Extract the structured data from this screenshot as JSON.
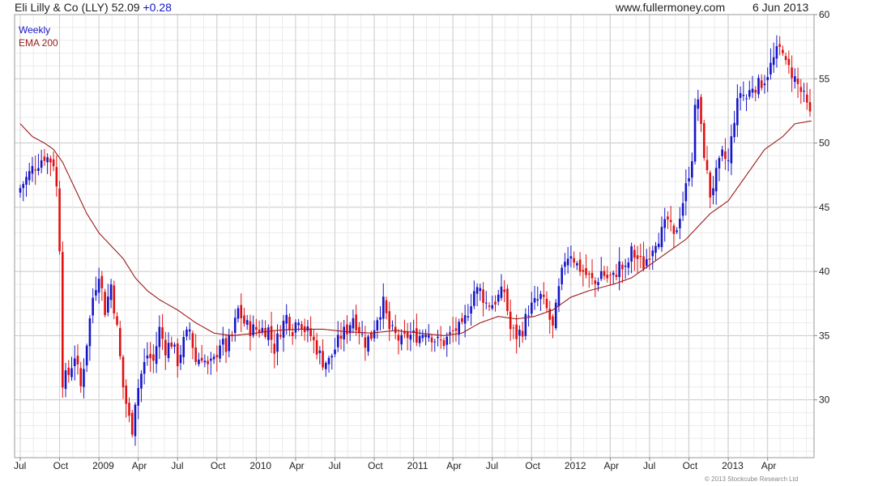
{
  "header": {
    "security": "Eli Lilly & Co (LLY)",
    "last_price": "52.09",
    "change": "+0.28",
    "website": "www.fullermoney.com",
    "date": "6 Jun 2013"
  },
  "legend": {
    "period": "Weekly",
    "indicator": "EMA 200"
  },
  "copyright": "© 2013 Stockcube Research Ltd",
  "colors": {
    "up": "#1515c8",
    "down": "#e01010",
    "ema": "#9b1b1b",
    "grid": "#d6d6d6"
  },
  "chart_data": {
    "type": "candlestick",
    "interval": "weekly",
    "y_ticks": [
      30,
      35,
      40,
      45,
      50,
      55,
      60
    ],
    "x_ticks": [
      {
        "label": "Jul",
        "week": 0
      },
      {
        "label": "Oct",
        "week": 13
      },
      {
        "label": "2009",
        "week": 26
      },
      {
        "label": "Apr",
        "week": 39
      },
      {
        "label": "Jul",
        "week": 52
      },
      {
        "label": "Oct",
        "week": 65
      },
      {
        "label": "2010",
        "week": 78
      },
      {
        "label": "Apr",
        "week": 91
      },
      {
        "label": "Jul",
        "week": 104
      },
      {
        "label": "Oct",
        "week": 117
      },
      {
        "label": "2011",
        "week": 130
      },
      {
        "label": "Apr",
        "week": 143
      },
      {
        "label": "Jul",
        "week": 156
      },
      {
        "label": "Oct",
        "week": 169
      },
      {
        "label": "2012",
        "week": 182
      },
      {
        "label": "Apr",
        "week": 195
      },
      {
        "label": "Jul",
        "week": 208
      },
      {
        "label": "Oct",
        "week": 221
      },
      {
        "label": "2013",
        "week": 234
      },
      {
        "label": "Apr",
        "week": 247
      }
    ],
    "ylim": [
      25.5,
      60
    ],
    "weeks": 262,
    "close_path": [
      [
        0,
        46.5
      ],
      [
        4,
        48.0
      ],
      [
        8,
        49.0
      ],
      [
        11,
        48.5
      ],
      [
        12,
        46.5
      ],
      [
        13,
        42.0
      ],
      [
        14,
        31.5
      ],
      [
        16,
        32.0
      ],
      [
        18,
        33.5
      ],
      [
        20,
        31.0
      ],
      [
        22,
        34.5
      ],
      [
        24,
        38.0
      ],
      [
        26,
        40.0
      ],
      [
        28,
        37.0
      ],
      [
        30,
        39.0
      ],
      [
        32,
        35.5
      ],
      [
        34,
        31.0
      ],
      [
        36,
        28.5
      ],
      [
        37,
        27.8
      ],
      [
        38,
        30.0
      ],
      [
        40,
        32.0
      ],
      [
        42,
        33.5
      ],
      [
        44,
        33.0
      ],
      [
        46,
        35.5
      ],
      [
        48,
        34.0
      ],
      [
        50,
        34.5
      ],
      [
        52,
        33.0
      ],
      [
        54,
        34.5
      ],
      [
        56,
        35.5
      ],
      [
        58,
        33.0
      ],
      [
        60,
        33.5
      ],
      [
        62,
        32.5
      ],
      [
        64,
        33.0
      ],
      [
        66,
        34.5
      ],
      [
        68,
        34.0
      ],
      [
        70,
        35.0
      ],
      [
        72,
        37.0
      ],
      [
        74,
        36.0
      ],
      [
        76,
        35.5
      ],
      [
        78,
        35.5
      ],
      [
        80,
        35.5
      ],
      [
        82,
        35.5
      ],
      [
        84,
        34.0
      ],
      [
        86,
        35.5
      ],
      [
        88,
        36.5
      ],
      [
        90,
        35.5
      ],
      [
        92,
        36.5
      ],
      [
        94,
        35.5
      ],
      [
        96,
        35.0
      ],
      [
        98,
        34.0
      ],
      [
        100,
        33.0
      ],
      [
        102,
        33.0
      ],
      [
        104,
        34.0
      ],
      [
        106,
        35.0
      ],
      [
        108,
        35.5
      ],
      [
        110,
        36.5
      ],
      [
        112,
        35.5
      ],
      [
        114,
        34.5
      ],
      [
        116,
        35.0
      ],
      [
        118,
        36.5
      ],
      [
        120,
        37.5
      ],
      [
        122,
        35.5
      ],
      [
        124,
        35.0
      ],
      [
        126,
        34.5
      ],
      [
        128,
        35.0
      ],
      [
        130,
        35.0
      ],
      [
        132,
        35.0
      ],
      [
        134,
        35.5
      ],
      [
        136,
        35.0
      ],
      [
        138,
        34.5
      ],
      [
        140,
        34.5
      ],
      [
        142,
        35.0
      ],
      [
        144,
        35.5
      ],
      [
        146,
        35.5
      ],
      [
        148,
        37.0
      ],
      [
        150,
        38.5
      ],
      [
        152,
        38.5
      ],
      [
        154,
        37.5
      ],
      [
        156,
        37.5
      ],
      [
        158,
        38.0
      ],
      [
        160,
        38.5
      ],
      [
        162,
        35.5
      ],
      [
        164,
        35.0
      ],
      [
        166,
        35.5
      ],
      [
        168,
        37.0
      ],
      [
        170,
        37.5
      ],
      [
        172,
        38.0
      ],
      [
        174,
        37.0
      ],
      [
        176,
        35.5
      ],
      [
        178,
        38.5
      ],
      [
        180,
        41.0
      ],
      [
        182,
        41.5
      ],
      [
        184,
        40.5
      ],
      [
        186,
        40.0
      ],
      [
        188,
        39.5
      ],
      [
        190,
        39.0
      ],
      [
        192,
        40.0
      ],
      [
        194,
        39.5
      ],
      [
        196,
        39.5
      ],
      [
        198,
        40.5
      ],
      [
        200,
        40.0
      ],
      [
        202,
        41.5
      ],
      [
        204,
        41.0
      ],
      [
        206,
        40.5
      ],
      [
        208,
        41.5
      ],
      [
        210,
        42.5
      ],
      [
        212,
        43.0
      ],
      [
        214,
        44.0
      ],
      [
        216,
        42.5
      ],
      [
        218,
        44.5
      ],
      [
        220,
        46.5
      ],
      [
        222,
        49.0
      ],
      [
        223,
        52.5
      ],
      [
        224,
        53.5
      ],
      [
        225,
        51.0
      ],
      [
        227,
        47.5
      ],
      [
        228,
        46.0
      ],
      [
        230,
        47.5
      ],
      [
        232,
        49.0
      ],
      [
        234,
        48.5
      ],
      [
        236,
        52.0
      ],
      [
        238,
        54.0
      ],
      [
        240,
        53.5
      ],
      [
        242,
        54.5
      ],
      [
        244,
        54.5
      ],
      [
        246,
        55.0
      ],
      [
        248,
        56.0
      ],
      [
        250,
        57.0
      ],
      [
        252,
        57.5
      ],
      [
        253,
        56.0
      ],
      [
        255,
        55.5
      ],
      [
        257,
        54.5
      ],
      [
        259,
        53.5
      ],
      [
        261,
        52.1
      ]
    ],
    "ema_path": [
      [
        0,
        51.5
      ],
      [
        4,
        50.5
      ],
      [
        8,
        50.0
      ],
      [
        11,
        49.5
      ],
      [
        14,
        48.5
      ],
      [
        18,
        46.5
      ],
      [
        22,
        44.5
      ],
      [
        26,
        43.0
      ],
      [
        30,
        42.0
      ],
      [
        34,
        41.0
      ],
      [
        38,
        39.5
      ],
      [
        42,
        38.5
      ],
      [
        46,
        37.8
      ],
      [
        52,
        37.0
      ],
      [
        58,
        36.0
      ],
      [
        64,
        35.2
      ],
      [
        70,
        35.0
      ],
      [
        78,
        35.2
      ],
      [
        84,
        35.4
      ],
      [
        92,
        35.5
      ],
      [
        100,
        35.5
      ],
      [
        108,
        35.3
      ],
      [
        116,
        35.2
      ],
      [
        124,
        35.4
      ],
      [
        132,
        35.2
      ],
      [
        140,
        35.0
      ],
      [
        146,
        35.2
      ],
      [
        152,
        36.0
      ],
      [
        158,
        36.5
      ],
      [
        164,
        36.3
      ],
      [
        170,
        36.5
      ],
      [
        176,
        37.0
      ],
      [
        182,
        38.0
      ],
      [
        188,
        38.5
      ],
      [
        196,
        39.0
      ],
      [
        202,
        39.5
      ],
      [
        208,
        40.5
      ],
      [
        214,
        41.5
      ],
      [
        220,
        42.5
      ],
      [
        224,
        43.5
      ],
      [
        228,
        44.5
      ],
      [
        234,
        45.5
      ],
      [
        240,
        47.5
      ],
      [
        246,
        49.5
      ],
      [
        252,
        50.5
      ],
      [
        256,
        51.5
      ],
      [
        261,
        51.7
      ]
    ]
  }
}
